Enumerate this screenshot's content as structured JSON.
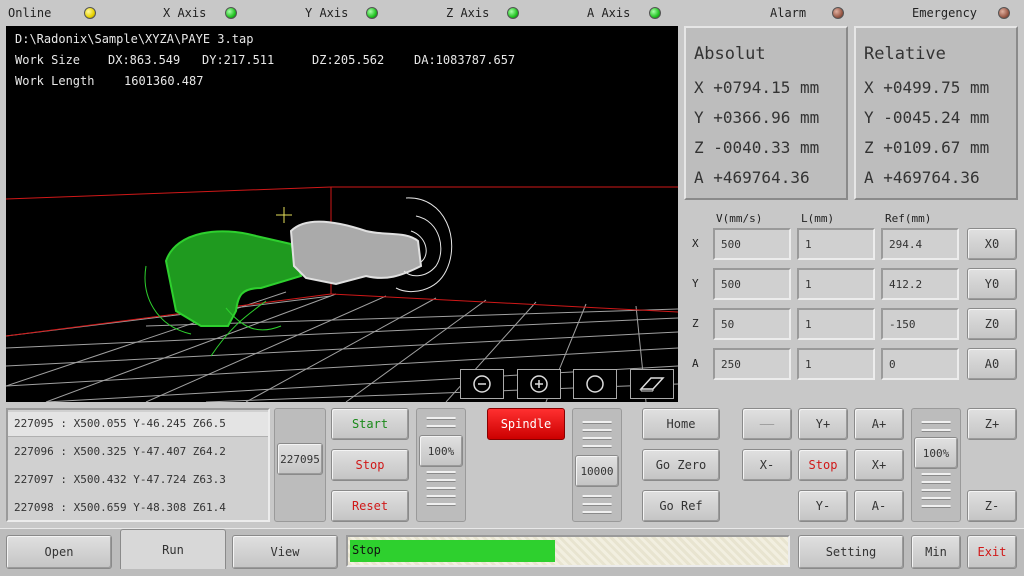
{
  "status": {
    "online": {
      "label": "Online",
      "led": "yellow"
    },
    "x_axis": {
      "label": "X Axis",
      "led": "green"
    },
    "y_axis": {
      "label": "Y Axis",
      "led": "green"
    },
    "z_axis": {
      "label": "Z Axis",
      "led": "green"
    },
    "a_axis": {
      "label": "A Axis",
      "led": "green"
    },
    "alarm": {
      "label": "Alarm",
      "led": "brown"
    },
    "emergency": {
      "label": "Emergency",
      "led": "brown"
    }
  },
  "viewport": {
    "file_path": "D:\\Radonix\\Sample\\XYZA\\PAYE 3.tap",
    "work_size_label": "Work Size",
    "dx": "DX:863.549",
    "dy": "DY:217.511",
    "dz": "DZ:205.562",
    "da": "DA:1083787.657",
    "work_length_label": "Work Length",
    "work_length": "1601360.487",
    "controls": [
      "zoom-out-icon",
      "zoom-in-icon",
      "circle-view-icon",
      "iso-view-icon"
    ]
  },
  "absolute": {
    "title": "Absolut",
    "rows": [
      "X +0794.15 mm",
      "Y +0366.96 mm",
      "Z -0040.33 mm",
      "A +469764.36"
    ]
  },
  "relative": {
    "title": "Relative",
    "rows": [
      "X +0499.75 mm",
      "Y -0045.24 mm",
      "Z +0109.67 mm",
      "A +469764.36"
    ]
  },
  "params": {
    "headers": [
      "V(mm/s)",
      "L(mm)",
      "Ref(mm)"
    ],
    "rows": [
      {
        "axis": "X",
        "v": "500",
        "l": "1",
        "ref": "294.4",
        "zero": "X0"
      },
      {
        "axis": "Y",
        "v": "500",
        "l": "1",
        "ref": "412.2",
        "zero": "Y0"
      },
      {
        "axis": "Z",
        "v": "50",
        "l": "1",
        "ref": "-150",
        "zero": "Z0"
      },
      {
        "axis": "A",
        "v": "250",
        "l": "1",
        "ref": "0",
        "zero": "A0"
      }
    ]
  },
  "log": [
    "227095 : X500.055 Y-46.245 Z66.5",
    "227096 : X500.325 Y-47.407 Z64.2",
    "227097 : X500.432 Y-47.724 Z63.3",
    "227098 : X500.659 Y-48.308 Z61.4"
  ],
  "line_slider": {
    "value": "227095"
  },
  "run": {
    "start": "Start",
    "stop": "Stop",
    "reset": "Reset"
  },
  "feed_override": {
    "value": "100%"
  },
  "spindle": {
    "label": "Spindle",
    "speed": "10000"
  },
  "motion": {
    "home": "Home",
    "go_zero": "Go Zero",
    "go_ref": "Go Ref"
  },
  "jog": {
    "blank": "——",
    "y_plus": "Y+",
    "a_plus": "A+",
    "x_minus": "X-",
    "stop": "Stop",
    "x_plus": "X+",
    "y_minus": "Y-",
    "a_minus": "A-",
    "z_plus": "Z+",
    "z_minus": "Z-",
    "override": "100%"
  },
  "bottom": {
    "open": "Open",
    "run": "Run",
    "view": "View",
    "progress_text": "Stop",
    "progress": 0.47,
    "setting": "Setting",
    "min": "Min",
    "exit": "Exit"
  },
  "colors": {
    "accent_green": "#2ed02e",
    "stop_red": "#d01818",
    "spindle_red": "#e00000"
  }
}
